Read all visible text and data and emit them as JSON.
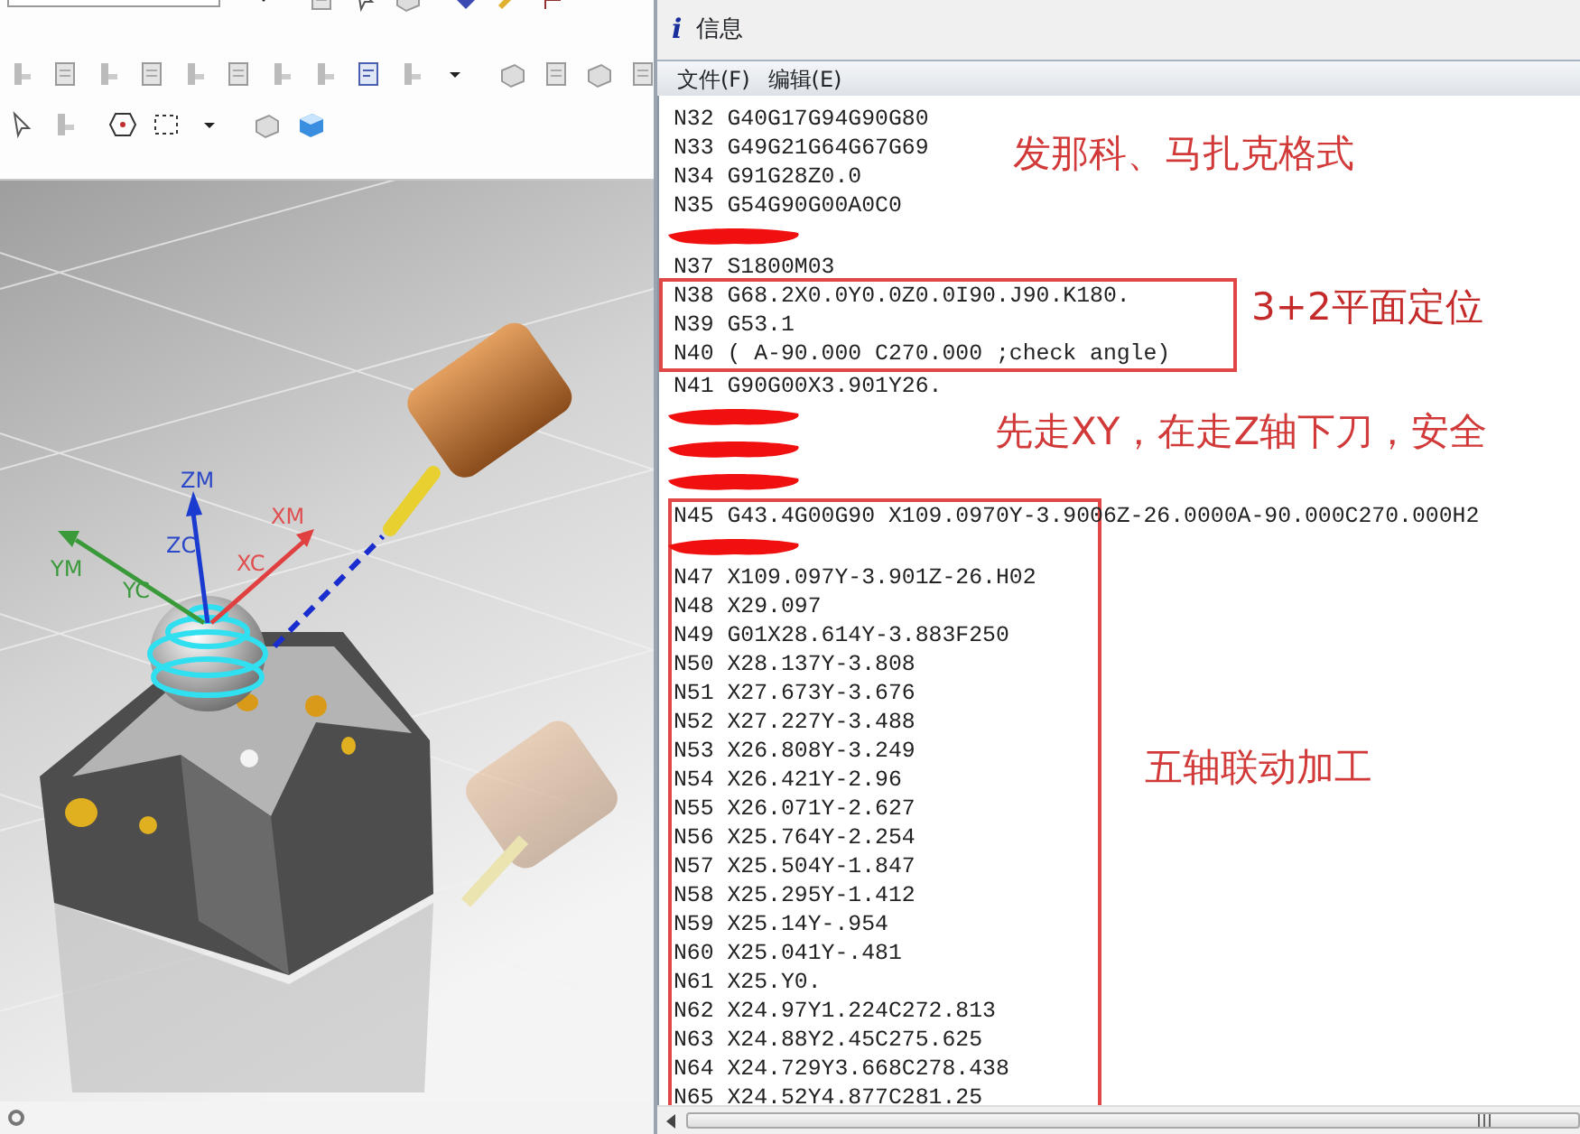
{
  "window": {
    "icon": "i",
    "title": "信息"
  },
  "menu": [
    {
      "label": "文件(F)"
    },
    {
      "label": "编辑(E)"
    }
  ],
  "listing": [
    {
      "kind": "plain",
      "note": "发那科、马扎克格式",
      "rows": [
        {
          "kind": "code",
          "text": "N32 G40G17G94G90G80"
        },
        {
          "kind": "code",
          "text": "N33 G49G21G64G67G69"
        },
        {
          "kind": "code",
          "text": "N34 G91G28Z0.0"
        },
        {
          "kind": "code",
          "text": "N35 G54G90G00A0C0"
        },
        {
          "kind": "scribble"
        },
        {
          "kind": "code",
          "text": "N37 S1800M03"
        }
      ]
    },
    {
      "kind": "boxed",
      "note": "3+2平面定位",
      "rows": [
        {
          "kind": "code",
          "text": "N38 G68.2X0.0Y0.0Z0.0I90.J90.K180."
        },
        {
          "kind": "code",
          "text": "N39 G53.1"
        },
        {
          "kind": "code",
          "text": "N40 ( A-90.000 C270.000 ;check angle)"
        }
      ]
    },
    {
      "kind": "plain",
      "note": "先走XY，在走Z轴下刀，安全",
      "rows": [
        {
          "kind": "code",
          "text": "N41 G90G00X3.901Y26."
        },
        {
          "kind": "scribble"
        },
        {
          "kind": "scribble"
        },
        {
          "kind": "scribble"
        }
      ]
    },
    {
      "kind": "boxed",
      "note": "五轴联动加工",
      "rows": [
        {
          "kind": "code",
          "text": "N45 G43.4G00G90 X109.0970Y-3.9006Z-26.0000A-90.000C270.000H2"
        },
        {
          "kind": "scribble"
        },
        {
          "kind": "code",
          "text": "N47 X109.097Y-3.901Z-26.H02"
        },
        {
          "kind": "code",
          "text": "N48 X29.097"
        },
        {
          "kind": "code",
          "text": "N49 G01X28.614Y-3.883F250"
        },
        {
          "kind": "code",
          "text": "N50 X28.137Y-3.808"
        },
        {
          "kind": "code",
          "text": "N51 X27.673Y-3.676"
        },
        {
          "kind": "code",
          "text": "N52 X27.227Y-3.488"
        },
        {
          "kind": "code",
          "text": "N53 X26.808Y-3.249"
        },
        {
          "kind": "code",
          "text": "N54 X26.421Y-2.96"
        },
        {
          "kind": "code",
          "text": "N55 X26.071Y-2.627"
        },
        {
          "kind": "code",
          "text": "N56 X25.764Y-2.254"
        },
        {
          "kind": "code",
          "text": "N57 X25.504Y-1.847"
        },
        {
          "kind": "code",
          "text": "N58 X25.295Y-1.412"
        },
        {
          "kind": "code",
          "text": "N59 X25.14Y-.954"
        },
        {
          "kind": "code",
          "text": "N60 X25.041Y-.481"
        },
        {
          "kind": "code",
          "text": "N61 X25.Y0."
        },
        {
          "kind": "code",
          "text": "N62 X24.97Y1.224C272.813"
        },
        {
          "kind": "code",
          "text": "N63 X24.88Y2.45C275.625"
        },
        {
          "kind": "code",
          "text": "N64 X24.729Y3.668C278.438"
        },
        {
          "kind": "code",
          "text": "N65 X24.52Y4.877C281.25"
        }
      ]
    }
  ],
  "viewport": {
    "axis_labels": [
      {
        "text": "ZM",
        "color": "#2a48c8"
      },
      {
        "text": "ZC",
        "color": "#2a48c8"
      },
      {
        "text": "XM",
        "color": "#e05050"
      },
      {
        "text": "XC",
        "color": "#e05050"
      },
      {
        "text": "YM",
        "color": "#3c9a3c"
      },
      {
        "text": "YC",
        "color": "#3c9a3c"
      }
    ]
  }
}
